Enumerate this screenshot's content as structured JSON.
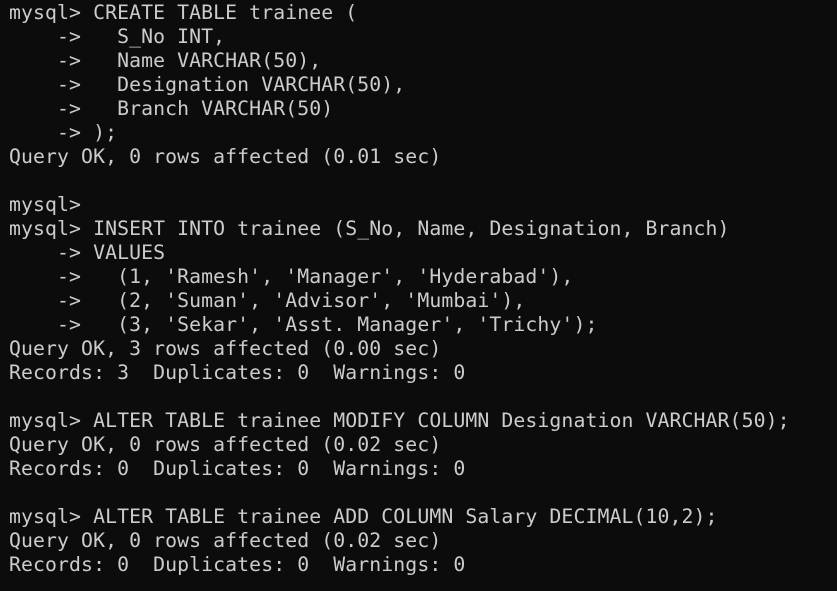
{
  "terminal": {
    "lines": [
      "mysql> CREATE TABLE trainee (",
      "    ->   S_No INT,",
      "    ->   Name VARCHAR(50),",
      "    ->   Designation VARCHAR(50),",
      "    ->   Branch VARCHAR(50)",
      "    -> );",
      "Query OK, 0 rows affected (0.01 sec)",
      "",
      "mysql>",
      "mysql> INSERT INTO trainee (S_No, Name, Designation, Branch)",
      "    -> VALUES",
      "    ->   (1, 'Ramesh', 'Manager', 'Hyderabad'),",
      "    ->   (2, 'Suman', 'Advisor', 'Mumbai'),",
      "    ->   (3, 'Sekar', 'Asst. Manager', 'Trichy');",
      "Query OK, 3 rows affected (0.00 sec)",
      "Records: 3  Duplicates: 0  Warnings: 0",
      "",
      "mysql> ALTER TABLE trainee MODIFY COLUMN Designation VARCHAR(50);",
      "Query OK, 0 rows affected (0.02 sec)",
      "Records: 0  Duplicates: 0  Warnings: 0",
      "",
      "mysql> ALTER TABLE trainee ADD COLUMN Salary DECIMAL(10,2);",
      "Query OK, 0 rows affected (0.02 sec)",
      "Records: 0  Duplicates: 0  Warnings: 0"
    ]
  }
}
